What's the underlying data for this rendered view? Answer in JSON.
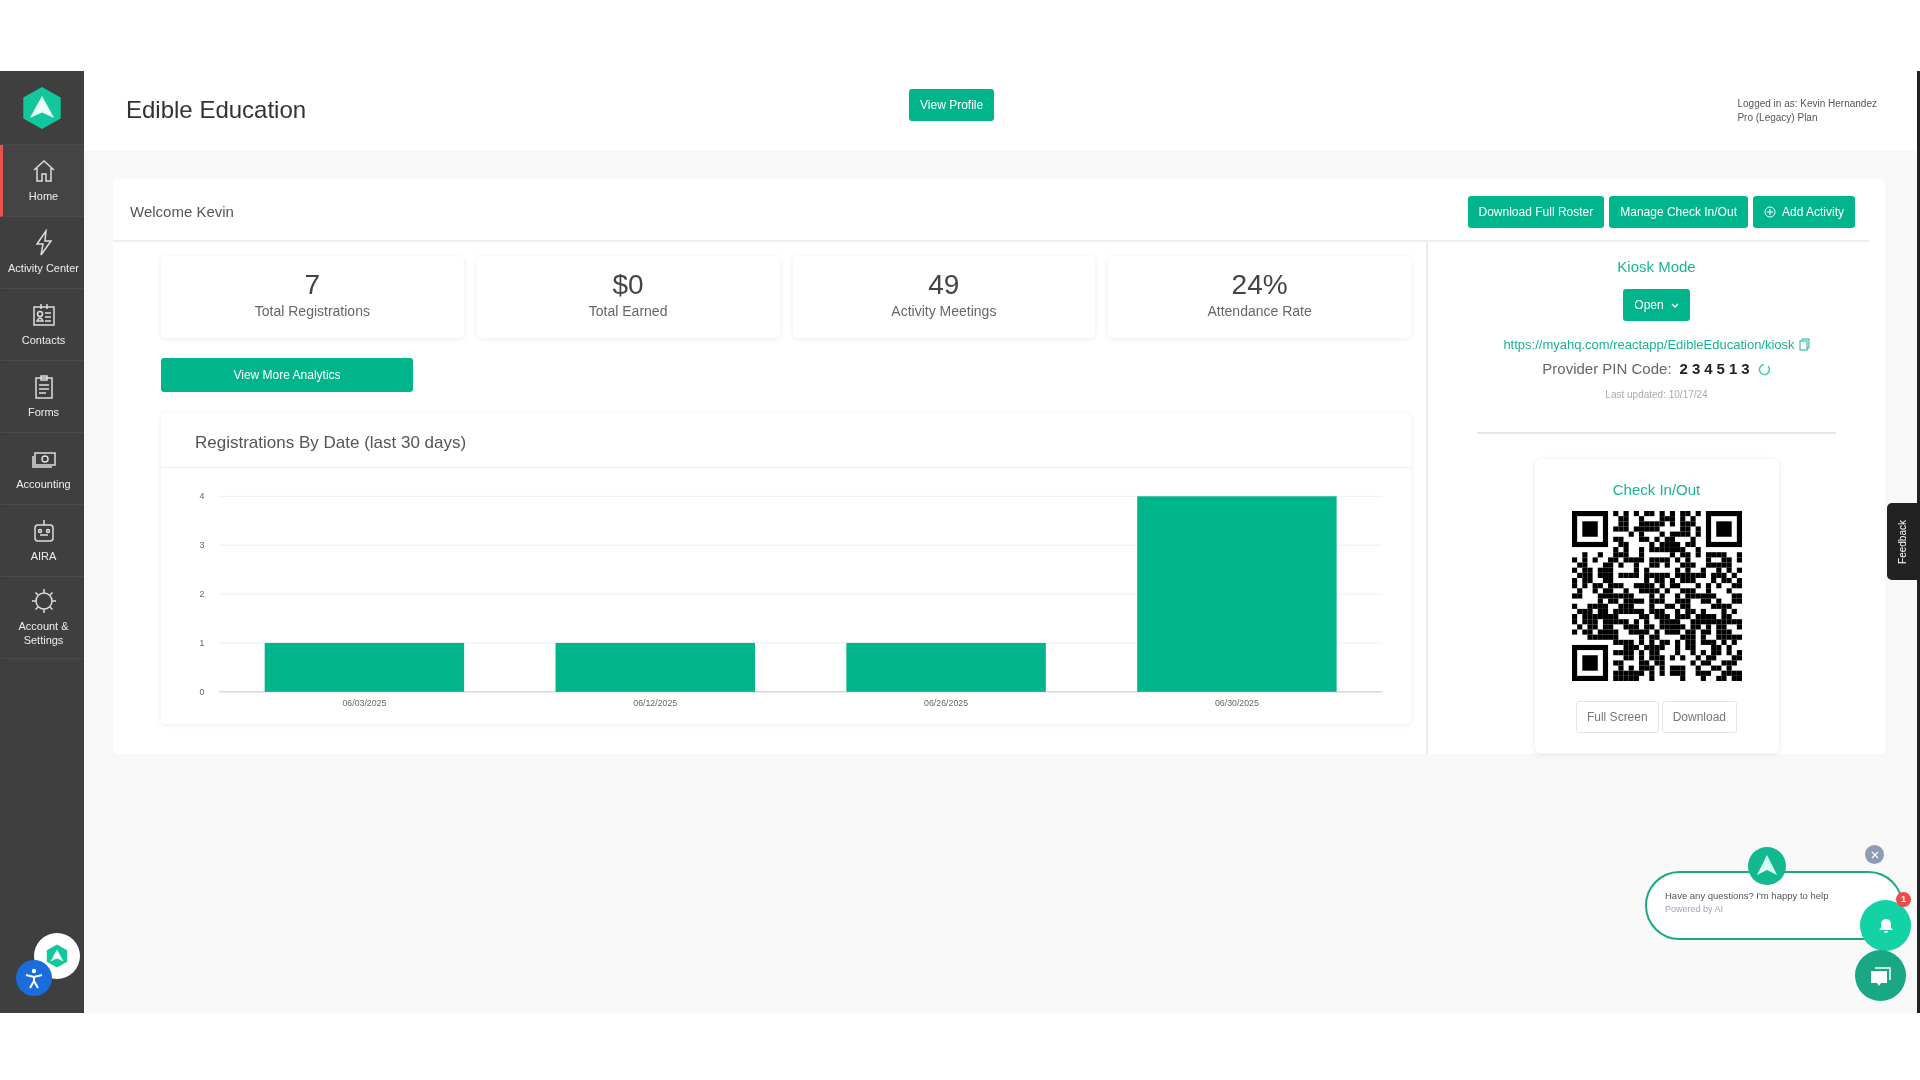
{
  "sidebar": {
    "items": [
      {
        "label": "Home",
        "selected": true
      },
      {
        "label": "Activity Center",
        "selected": false
      },
      {
        "label": "Contacts",
        "selected": false
      },
      {
        "label": "Forms",
        "selected": false
      },
      {
        "label": "Accounting",
        "selected": false
      },
      {
        "label": "AIRA",
        "selected": false
      },
      {
        "label": "Account & Settings",
        "selected": false
      }
    ]
  },
  "header": {
    "title": "Edible Education",
    "profile_button": "View Profile",
    "login_label": "Logged in as:",
    "user_name": "Kevin Hernandez",
    "plan": "Pro (Legacy) Plan"
  },
  "welcome": "Welcome Kevin",
  "actions": [
    {
      "label": "Download Full Roster",
      "kind": "plain"
    },
    {
      "label": "Manage Check In/Out",
      "kind": "plain"
    },
    {
      "label": "Add Activity",
      "kind": "add"
    }
  ],
  "stats": [
    {
      "value": "7",
      "label": "Total Registrations"
    },
    {
      "value": "$0",
      "label": "Total Earned"
    },
    {
      "value": "49",
      "label": "Activity Meetings"
    },
    {
      "value": "24%",
      "label": "Attendance Rate"
    }
  ],
  "analytics_button": "View More Analytics",
  "chart": {
    "title": "Registrations By Date (last 30 days)",
    "chart_data": {
      "type": "bar",
      "categories": [
        "06/03/2025",
        "06/12/2025",
        "06/26/2025",
        "06/30/2025"
      ],
      "values": [
        1,
        1,
        1,
        4
      ],
      "grid": true,
      "ylim": [
        0,
        4
      ],
      "yticks": [
        0,
        1,
        2,
        3,
        4
      ]
    }
  },
  "kiosk": {
    "title": "Kiosk Mode",
    "open_button": "Open",
    "url": "https://myahq.com/reactapp/EdibleEducation/kiosk",
    "pin_label": "Provider PIN Code:",
    "pin": "234513",
    "updated": "Last updated: 10/17/24"
  },
  "check_in": {
    "title": "Check In/Out",
    "buttons": [
      "Full Screen",
      "Download"
    ]
  },
  "feedback": "Feedback",
  "chat": {
    "message": "Have any questions? I'm happy to help",
    "powered": "Powered by AI",
    "badge": "1"
  }
}
